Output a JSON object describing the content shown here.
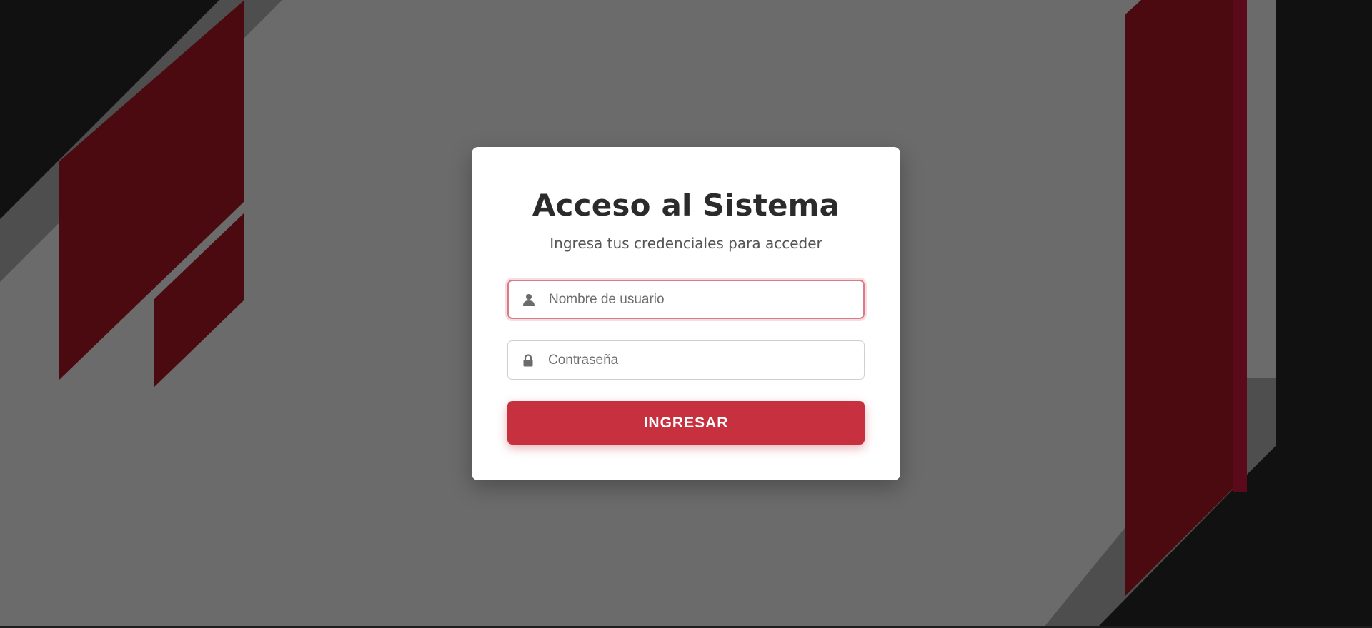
{
  "login": {
    "title": "Acceso al Sistema",
    "subtitle": "Ingresa tus credenciales para acceder",
    "username_placeholder": "Nombre de usuario",
    "username_value": "",
    "password_placeholder": "Contraseña",
    "password_value": "",
    "submit_label": "INGRESAR",
    "username_icon": "user-icon",
    "password_icon": "lock-icon"
  },
  "colors": {
    "accent": "#c7313f",
    "background": "#6b6b6b",
    "dark_band": "#111111",
    "red_shape": "#4b0a10",
    "card": "#ffffff"
  }
}
